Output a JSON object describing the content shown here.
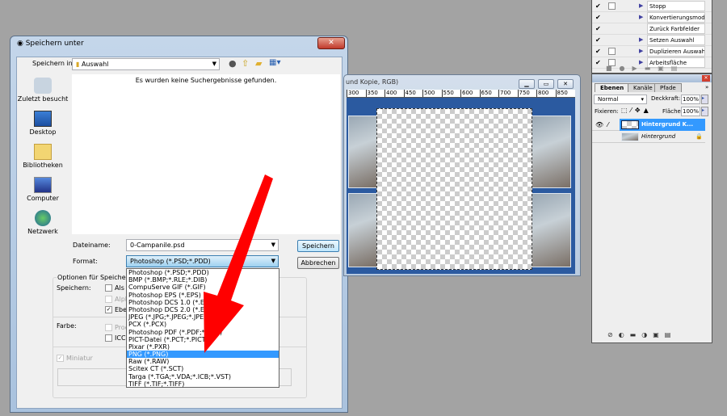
{
  "dialog": {
    "title": "Speichern unter",
    "close_label": "✕",
    "save_in_label": "Speichern in:",
    "save_in_value": "Auswahl",
    "empty_message": "Es wurden keine Suchergebnisse gefunden.",
    "places": [
      {
        "label": "Zuletzt besucht",
        "icon": "recent-icon"
      },
      {
        "label": "Desktop",
        "icon": "desktop-icon"
      },
      {
        "label": "Bibliotheken",
        "icon": "libraries-icon"
      },
      {
        "label": "Computer",
        "icon": "computer-icon"
      },
      {
        "label": "Netzwerk",
        "icon": "network-icon"
      }
    ],
    "filename_label": "Dateiname:",
    "filename_value": "0-Campanile.psd",
    "format_label": "Format:",
    "format_value": "Photoshop (*.PSD;*.PDD)",
    "save_button": "Speichern",
    "cancel_button": "Abbrechen",
    "options": {
      "title": "Optionen für Speichern",
      "save_label": "Speichern:",
      "save_checks": [
        {
          "label": "Als K",
          "checked": false,
          "disabled": false
        },
        {
          "label": "Alph",
          "checked": false,
          "disabled": true
        },
        {
          "label": "Eben",
          "checked": true,
          "disabled": false
        }
      ],
      "color_label": "Farbe:",
      "color_checks": [
        {
          "label": "Proo",
          "checked": false,
          "disabled": true
        },
        {
          "label": "ICC-",
          "checked": false,
          "disabled": false
        }
      ],
      "thumbnail_label": "Miniatur",
      "thumbnail_checked": true
    },
    "format_options": [
      "Photoshop (*.PSD;*.PDD)",
      "BMP (*.BMP;*.RLE;*.DIB)",
      "CompuServe GIF (*.GIF)",
      "Photoshop EPS (*.EPS)",
      "Photoshop DCS 1.0 (*.EPS)",
      "Photoshop DCS 2.0 (*.EPS)",
      "JPEG (*.JPG;*.JPEG;*.JPE)",
      "PCX (*.PCX)",
      "Photoshop PDF (*.PDF;*.PDP)",
      "PICT-Datei (*.PCT;*.PICT)",
      "Pixar (*.PXR)",
      "PNG (*.PNG)",
      "Raw (*.RAW)",
      "Scitex CT (*.SCT)",
      "Targa (*.TGA;*.VDA;*.ICB;*.VST)",
      "TIFF (*.TIF;*.TIFF)"
    ],
    "highlighted_option": "PNG (*.PNG)"
  },
  "document": {
    "title": "und Kopie, RGB)",
    "ruler": [
      "300",
      "350",
      "400",
      "450",
      "500",
      "550",
      "600",
      "650",
      "700",
      "750",
      "800",
      "850"
    ]
  },
  "actions": {
    "items": [
      "Stopp",
      "Konvertierungsmod...",
      "Zurück Farbfelder",
      "Setzen Auswahl",
      "Duplizieren Auswahl",
      "Arbeitsfläche"
    ]
  },
  "layers": {
    "tabs": [
      "Ebenen",
      "Kanäle",
      "Pfade"
    ],
    "blend_mode": "Normal",
    "opacity_label": "Deckkraft:",
    "opacity_value": "100%",
    "lock_label": "Fixieren:",
    "fill_label": "Fläche:",
    "fill_value": "100%",
    "items": [
      {
        "name": "Hintergrund K...",
        "selected": true
      },
      {
        "name": "Hintergrund",
        "selected": false,
        "locked": true
      }
    ]
  },
  "colors": {
    "accent": "#3399ff",
    "arrow": "#ff0000",
    "canvas": "#2b5aa0"
  }
}
